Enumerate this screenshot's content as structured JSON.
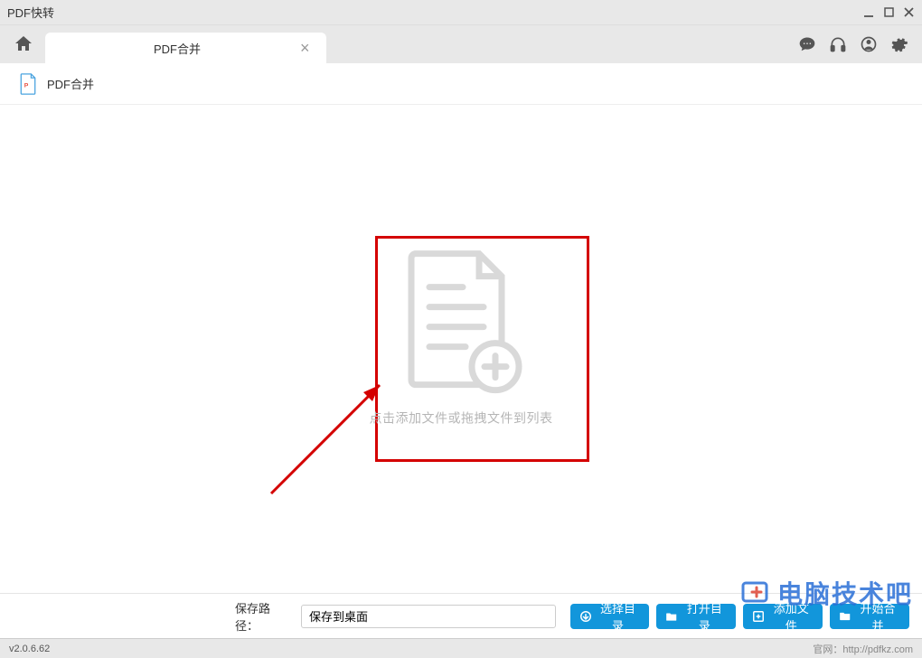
{
  "window": {
    "title": "PDF快转"
  },
  "tab": {
    "label": "PDF合并"
  },
  "subheader": {
    "label": "PDF合并"
  },
  "dropzone": {
    "text": "点击添加文件或拖拽文件到列表"
  },
  "footer": {
    "savePathLabel": "保存路径：",
    "savePathValue": "保存到桌面",
    "selectDir": "选择目录",
    "openDir": "打开目录",
    "addFile": "添加文件",
    "startMerge": "开始合并"
  },
  "status": {
    "version": "v2.0.6.62",
    "officialLabel": "官网：",
    "officialUrl": "http://pdfkz.com"
  },
  "watermark": {
    "text": "电脑技术吧"
  }
}
